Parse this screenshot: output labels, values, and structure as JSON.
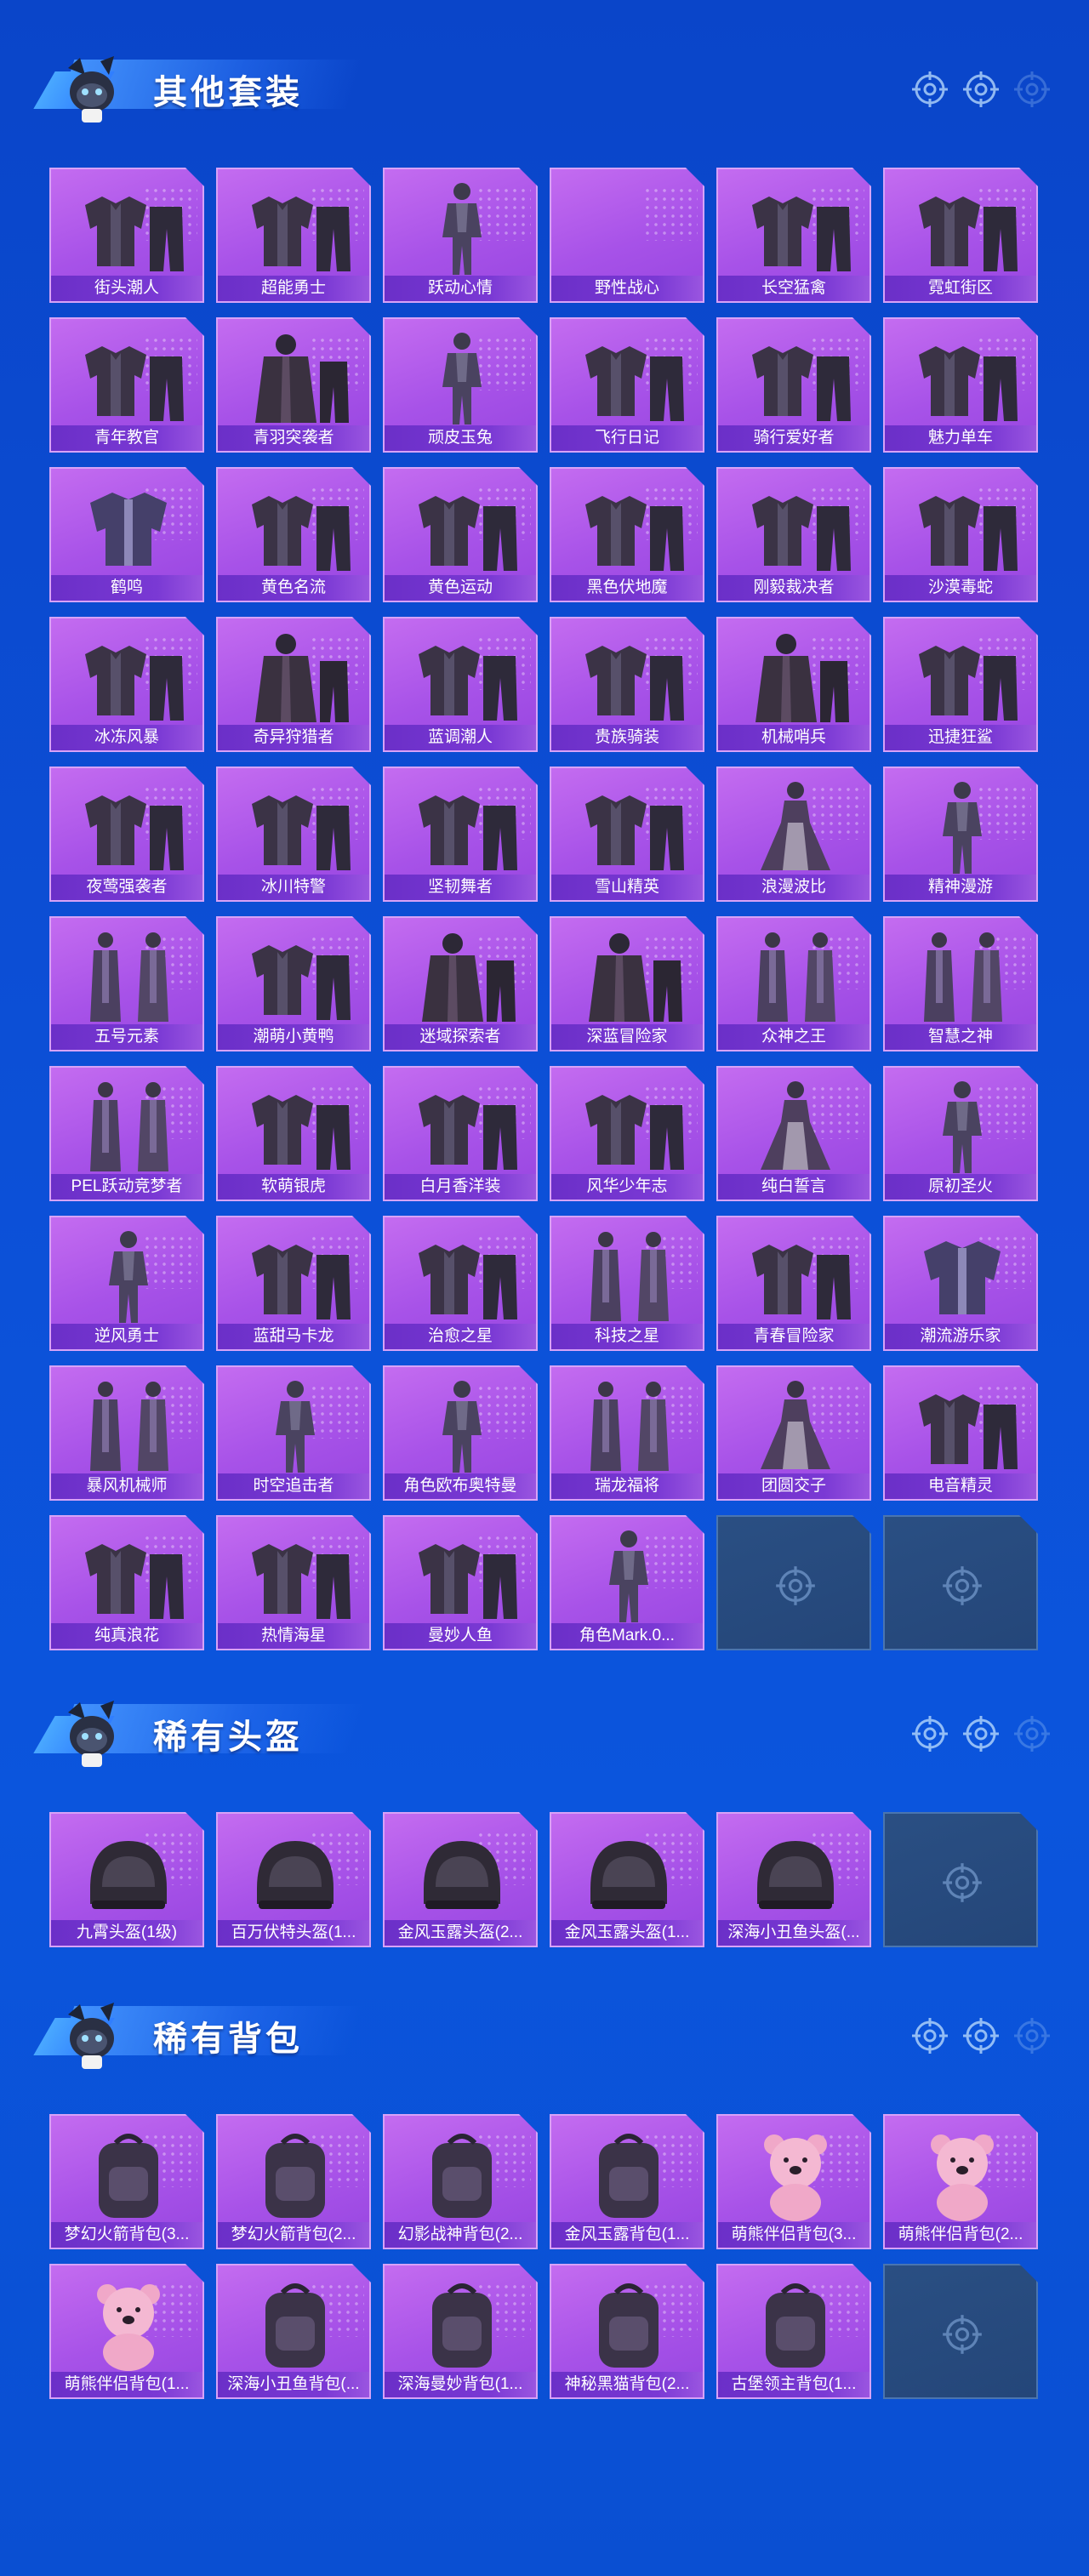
{
  "sections": [
    {
      "title": "其他套装",
      "items": [
        {
          "label": "街头潮人",
          "art": "jacket-pants"
        },
        {
          "label": "超能勇士",
          "art": "jacket-pants"
        },
        {
          "label": "跃动心情",
          "art": "figure"
        },
        {
          "label": "野性战心",
          "art": "vest-pants"
        },
        {
          "label": "长空猛禽",
          "art": "jacket-pants"
        },
        {
          "label": "霓虹街区",
          "art": "jacket-pants"
        },
        {
          "label": "青年教官",
          "art": "jacket-pants"
        },
        {
          "label": "青羽突袭者",
          "art": "coat"
        },
        {
          "label": "顽皮玉兔",
          "art": "figure"
        },
        {
          "label": "飞行日记",
          "art": "jacket-pants"
        },
        {
          "label": "骑行爱好者",
          "art": "jacket-pants"
        },
        {
          "label": "魅力单车",
          "art": "jacket-pants"
        },
        {
          "label": "鹤鸣",
          "art": "jacket"
        },
        {
          "label": "黄色名流",
          "art": "jacket-pants"
        },
        {
          "label": "黄色运动",
          "art": "jacket-pants"
        },
        {
          "label": "黑色伏地魔",
          "art": "jacket-pants"
        },
        {
          "label": "刚毅裁决者",
          "art": "jacket-pants"
        },
        {
          "label": "沙漠毒蛇",
          "art": "jacket-pants"
        },
        {
          "label": "冰冻风暴",
          "art": "jacket-pants"
        },
        {
          "label": "奇异狩猎者",
          "art": "coat"
        },
        {
          "label": "蓝调潮人",
          "art": "jacket-pants"
        },
        {
          "label": "贵族骑装",
          "art": "jacket-pants"
        },
        {
          "label": "机械哨兵",
          "art": "coat"
        },
        {
          "label": "迅捷狂鲨",
          "art": "jacket-pants"
        },
        {
          "label": "夜莺强袭者",
          "art": "jacket-pants"
        },
        {
          "label": "冰川特警",
          "art": "jacket-pants"
        },
        {
          "label": "坚韧舞者",
          "art": "jacket-pants"
        },
        {
          "label": "雪山精英",
          "art": "jacket-pants"
        },
        {
          "label": "浪漫波比",
          "art": "dress"
        },
        {
          "label": "精神漫游",
          "art": "figure"
        },
        {
          "label": "五号元素",
          "art": "figures"
        },
        {
          "label": "潮萌小黄鸭",
          "art": "jacket-pants"
        },
        {
          "label": "迷域探索者",
          "art": "coat"
        },
        {
          "label": "深蓝冒险家",
          "art": "coat"
        },
        {
          "label": "众神之王",
          "art": "figures"
        },
        {
          "label": "智慧之神",
          "art": "figures"
        },
        {
          "label": "PEL跃动竞梦者",
          "art": "figures"
        },
        {
          "label": "软萌银虎",
          "art": "jacket-pants"
        },
        {
          "label": "白月香洋装",
          "art": "jacket-pants"
        },
        {
          "label": "风华少年志",
          "art": "jacket-pants"
        },
        {
          "label": "纯白誓言",
          "art": "dress"
        },
        {
          "label": "原初圣火",
          "art": "figure"
        },
        {
          "label": "逆风勇士",
          "art": "figure"
        },
        {
          "label": "蓝甜马卡龙",
          "art": "jacket-pants"
        },
        {
          "label": "治愈之星",
          "art": "jacket-pants"
        },
        {
          "label": "科技之星",
          "art": "figures"
        },
        {
          "label": "青春冒险家",
          "art": "jacket-pants"
        },
        {
          "label": "潮流游乐家",
          "art": "jacket"
        },
        {
          "label": "暴风机械师",
          "art": "figures"
        },
        {
          "label": "时空追击者",
          "art": "figure"
        },
        {
          "label": "角色欧布奥特曼",
          "art": "figure"
        },
        {
          "label": "瑞龙福将",
          "art": "figures"
        },
        {
          "label": "团圆交子",
          "art": "dress"
        },
        {
          "label": "电音精灵",
          "art": "jacket-pants"
        },
        {
          "label": "纯真浪花",
          "art": "jacket-pants"
        },
        {
          "label": "热情海星",
          "art": "jacket-pants"
        },
        {
          "label": "曼妙人鱼",
          "art": "jacket-pants"
        },
        {
          "label": "角色Mark.0...",
          "art": "figure"
        }
      ],
      "empty_slots": 2
    },
    {
      "title": "稀有头盔",
      "items": [
        {
          "label": "九霄头盔(1级)",
          "art": "helmet"
        },
        {
          "label": "百万伏特头盔(1...",
          "art": "helmet"
        },
        {
          "label": "金风玉露头盔(2...",
          "art": "helmet"
        },
        {
          "label": "金风玉露头盔(1...",
          "art": "helmet"
        },
        {
          "label": "深海小丑鱼头盔(...",
          "art": "helmet"
        }
      ],
      "empty_slots": 1
    },
    {
      "title": "稀有背包",
      "items": [
        {
          "label": "梦幻火箭背包(3...",
          "art": "backpack"
        },
        {
          "label": "梦幻火箭背包(2...",
          "art": "backpack"
        },
        {
          "label": "幻影战神背包(2...",
          "art": "backpack"
        },
        {
          "label": "金风玉露背包(1...",
          "art": "backpack"
        },
        {
          "label": "萌熊伴侣背包(3...",
          "art": "bear"
        },
        {
          "label": "萌熊伴侣背包(2...",
          "art": "bear"
        },
        {
          "label": "萌熊伴侣背包(1...",
          "art": "bear"
        },
        {
          "label": "深海小丑鱼背包(...",
          "art": "backpack"
        },
        {
          "label": "深海曼妙背包(1...",
          "art": "backpack"
        },
        {
          "label": "神秘黑猫背包(2...",
          "art": "backpack"
        },
        {
          "label": "古堡领主背包(1...",
          "art": "backpack"
        }
      ],
      "empty_slots": 1
    }
  ],
  "colors": {
    "background": "#0c4fd6",
    "card": "#a752e8",
    "card_label_bg": "#6b2fc8",
    "empty_card": "#264a7e"
  }
}
